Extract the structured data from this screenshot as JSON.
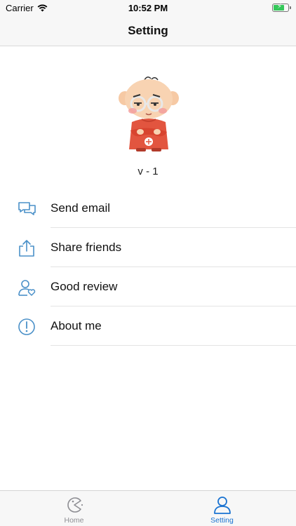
{
  "status_bar": {
    "carrier": "Carrier",
    "time": "10:52 PM",
    "battery_charging": true
  },
  "nav": {
    "title": "Setting"
  },
  "profile": {
    "avatar": "cartoon-boy-with-glasses",
    "version": "v - 1"
  },
  "menu": {
    "items": [
      {
        "label": "Send email",
        "icon": "chat-bubbles-icon"
      },
      {
        "label": "Share friends",
        "icon": "share-icon"
      },
      {
        "label": "Good review",
        "icon": "user-heart-icon"
      },
      {
        "label": "About me",
        "icon": "info-circle-icon"
      }
    ]
  },
  "tab_bar": {
    "tabs": [
      {
        "label": "Home",
        "icon": "pacman-icon",
        "selected": false
      },
      {
        "label": "Setting",
        "icon": "person-icon",
        "selected": true
      }
    ]
  },
  "colors": {
    "accent": "#1a73d1",
    "icon_blue": "#4a90c8",
    "tab_inactive": "#8e8e93",
    "bar_background": "#f7f7f7"
  }
}
